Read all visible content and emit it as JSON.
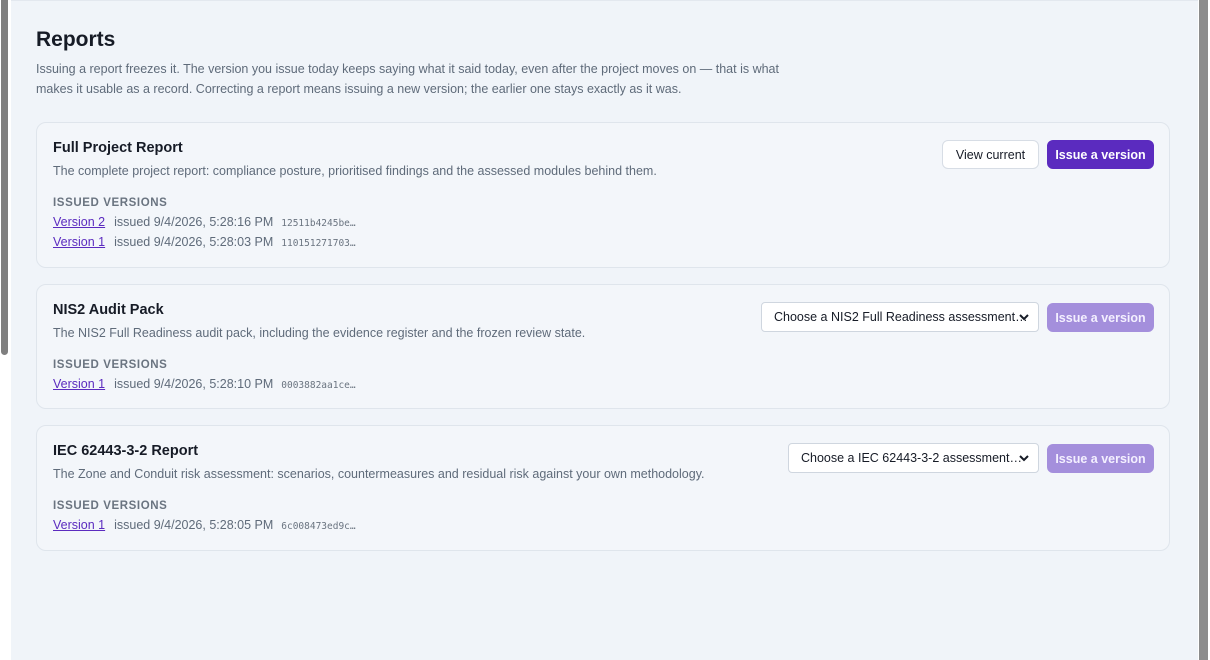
{
  "page": {
    "title": "Reports",
    "description": "Issuing a report freezes it. The version you issue today keeps saying what it said today, even after the project moves on — that is what makes it usable as a record. Correcting a report means issuing a new version; the earlier one stays exactly as it was."
  },
  "versions_heading": "ISSUED VERSIONS",
  "cards": [
    {
      "title": "Full Project Report",
      "description": "The complete project report: compliance posture, prioritised findings and the assessed modules behind them.",
      "view_current_label": "View current",
      "issue_label": "Issue a version",
      "versions": [
        {
          "label": "Version 2",
          "issued": "issued 9/4/2026, 5:28:16 PM",
          "hash": "12511b4245be…"
        },
        {
          "label": "Version 1",
          "issued": "issued 9/4/2026, 5:28:03 PM",
          "hash": "110151271703…"
        }
      ]
    },
    {
      "title": "NIS2 Audit Pack",
      "description": "The NIS2 Full Readiness audit pack, including the evidence register and the frozen review state.",
      "select_value": "Choose a NIS2 Full Readiness assessment…",
      "issue_label": "Issue a version",
      "versions": [
        {
          "label": "Version 1",
          "issued": "issued 9/4/2026, 5:28:10 PM",
          "hash": "0003882aa1ce…"
        }
      ]
    },
    {
      "title": "IEC 62443-3-2 Report",
      "description": "The Zone and Conduit risk assessment: scenarios, countermeasures and residual risk against your own methodology.",
      "select_value": "Choose a IEC 62443-3-2 assessment…",
      "issue_label": "Issue a version",
      "versions": [
        {
          "label": "Version 1",
          "issued": "issued 9/4/2026, 5:28:05 PM",
          "hash": "6c008473ed9c…"
        }
      ]
    }
  ],
  "colors": {
    "accent": "#5b2bbf",
    "accent_disabled": "#a48fdc",
    "background": "#f0f4f9"
  }
}
